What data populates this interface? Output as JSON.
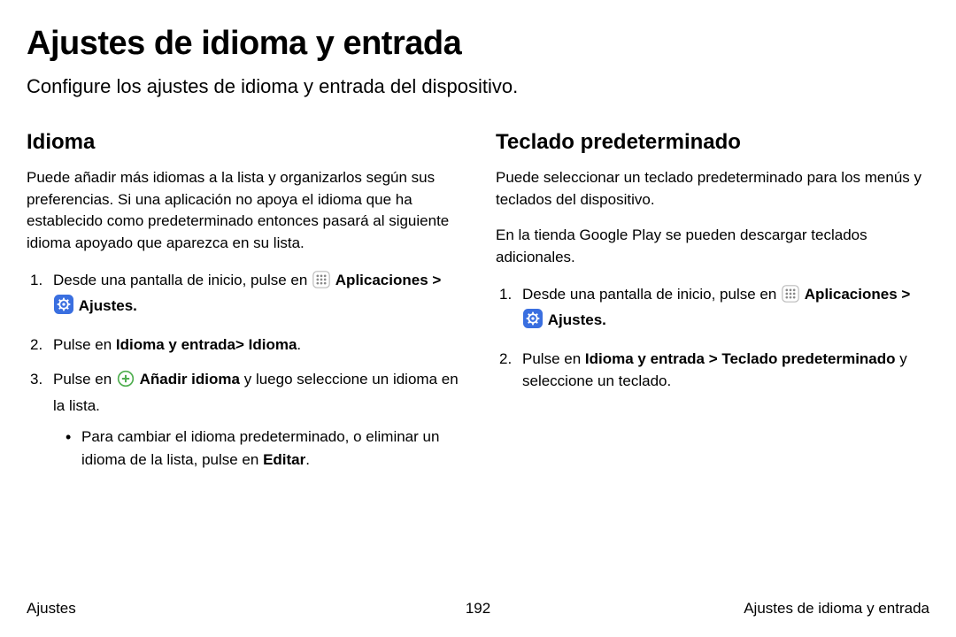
{
  "title": "Ajustes de idioma y entrada",
  "subtitle": "Configure los ajustes de idioma y entrada del dispositivo.",
  "chevron": ">",
  "labels": {
    "aplicaciones": "Aplicaciones",
    "ajustes": "Ajustes",
    "editar": "Editar",
    "anadir_idioma": "Añadir idioma"
  },
  "left": {
    "heading": "Idioma",
    "intro": "Puede añadir más idiomas a la lista y organizarlos según sus preferencias. Si una aplicación no apoya el idioma que ha establecido como predeterminado entonces pasará al siguiente idioma apoyado que aparezca en su lista.",
    "step1_lead": "Desde una pantalla de inicio, pulse en ",
    "step2_lead": "Pulse en ",
    "step2_bold": "Idioma y entrada> Idioma",
    "step2_tail": ".",
    "step3_lead": "Pulse en ",
    "step3_mid": " y luego seleccione un idioma en la lista.",
    "bullet_lead": "Para cambiar el idioma predeterminado, o eliminar un idioma de la lista, pulse en ",
    "bullet_tail": "."
  },
  "right": {
    "heading": "Teclado predeterminado",
    "intro1": "Puede seleccionar un teclado predeterminado para los menús y teclados del dispositivo.",
    "intro2": "En la tienda Google Play se pueden descargar teclados adicionales.",
    "step1_lead": "Desde una pantalla de inicio, pulse en ",
    "step2_lead": "Pulse en ",
    "step2_bold": "Idioma y entrada > Teclado predeterminado",
    "step2_tail": " y seleccione un teclado."
  },
  "footer": {
    "left": "Ajustes",
    "center": "192",
    "right": "Ajustes de idioma y entrada"
  }
}
